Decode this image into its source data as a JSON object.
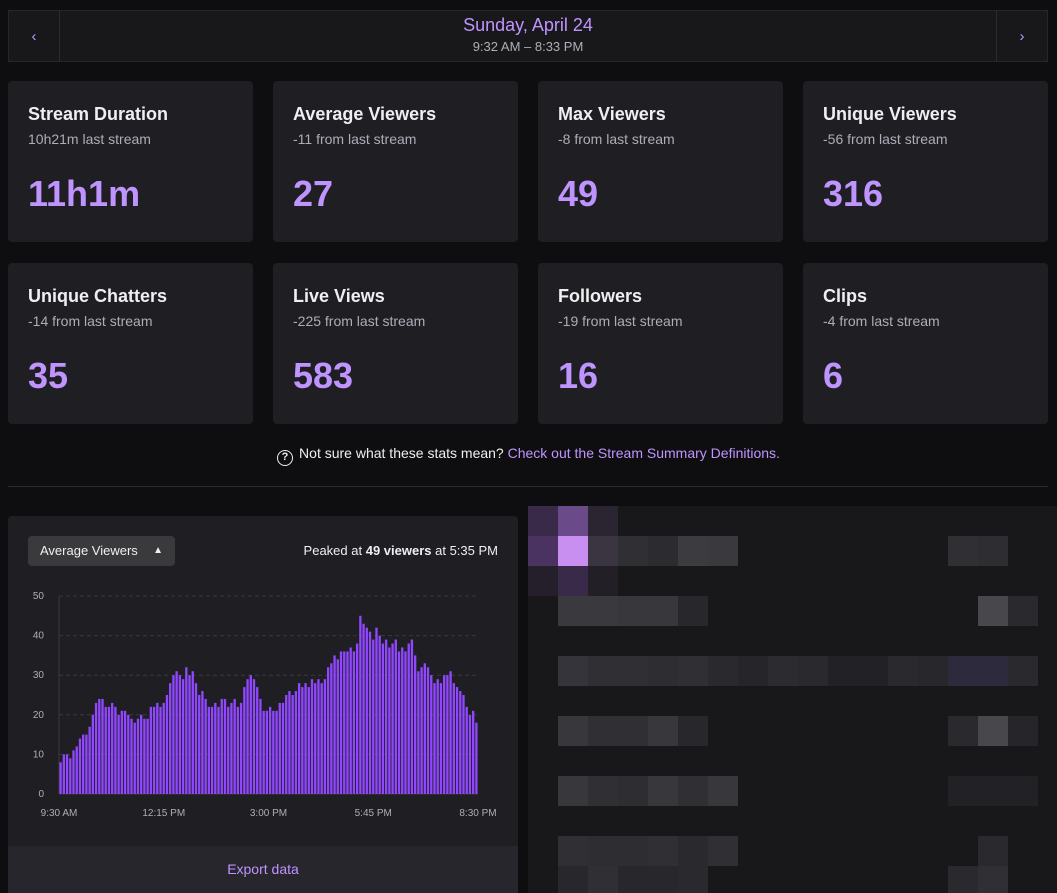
{
  "date_nav": {
    "prev_icon": "chevron-left",
    "next_icon": "chevron-right",
    "title": "Sunday, April 24",
    "time_range": "9:32 AM – 8:33 PM"
  },
  "stats": [
    {
      "title": "Stream Duration",
      "subtitle": "10h21m last stream",
      "value": "11h1m"
    },
    {
      "title": "Average Viewers",
      "subtitle": "-11 from last stream",
      "value": "27"
    },
    {
      "title": "Max Viewers",
      "subtitle": "-8 from last stream",
      "value": "49"
    },
    {
      "title": "Unique Viewers",
      "subtitle": "-56 from last stream",
      "value": "316"
    },
    {
      "title": "Unique Chatters",
      "subtitle": "-14 from last stream",
      "value": "35"
    },
    {
      "title": "Live Views",
      "subtitle": "-225 from last stream",
      "value": "583"
    },
    {
      "title": "Followers",
      "subtitle": "-19 from last stream",
      "value": "16"
    },
    {
      "title": "Clips",
      "subtitle": "-4 from last stream",
      "value": "6"
    }
  ],
  "help": {
    "icon": "question-circle-icon",
    "text": "Not sure what these stats mean?",
    "link": "Check out the Stream Summary Definitions."
  },
  "chart_panel": {
    "metric_select": "Average Viewers",
    "peak_prefix": "Peaked at",
    "peak_value": "49 viewers",
    "peak_suffix": "at 5:35 PM",
    "export_label": "Export data"
  },
  "colors": {
    "accent": "#bf94ff",
    "bar": "#9147ff",
    "background": "#0e0e10",
    "card": "#1f1f23"
  },
  "chart_data": {
    "type": "bar",
    "ylim": [
      0,
      50
    ],
    "yticks": [
      0,
      10,
      20,
      30,
      40,
      50
    ],
    "xticks": [
      "9:30 AM",
      "12:15 PM",
      "3:00 PM",
      "5:45 PM",
      "8:30 PM"
    ],
    "grid": "horizontal dashed",
    "values": [
      8,
      10,
      10,
      9,
      11,
      12,
      14,
      15,
      15,
      17,
      20,
      23,
      24,
      24,
      22,
      22,
      23,
      22,
      20,
      21,
      21,
      20,
      19,
      18,
      19,
      20,
      19,
      19,
      22,
      22,
      23,
      22,
      23,
      25,
      28,
      30,
      31,
      30,
      29,
      32,
      30,
      31,
      28,
      25,
      26,
      24,
      22,
      22,
      23,
      22,
      24,
      24,
      22,
      23,
      24,
      22,
      23,
      27,
      29,
      30,
      29,
      27,
      24,
      21,
      21,
      22,
      21,
      21,
      23,
      23,
      25,
      26,
      25,
      26,
      28,
      27,
      28,
      27,
      29,
      28,
      29,
      28,
      29,
      32,
      33,
      35,
      34,
      36,
      36,
      36,
      37,
      36,
      38,
      45,
      43,
      42,
      41,
      39,
      42,
      40,
      38,
      39,
      37,
      38,
      39,
      36,
      37,
      36,
      38,
      39,
      35,
      31,
      32,
      33,
      32,
      30,
      28,
      29,
      28,
      30,
      30,
      31,
      28,
      27,
      26,
      25,
      22,
      20,
      21,
      18
    ]
  },
  "heatmap": {
    "note": "redacted / pixelated panel",
    "cells": [
      {
        "c": 0,
        "r": 0,
        "color": "#3a2a4a"
      },
      {
        "c": 1,
        "r": 0,
        "color": "#6b4a8a"
      },
      {
        "c": 2,
        "r": 0,
        "color": "#2a2530"
      },
      {
        "c": 0,
        "r": 1,
        "color": "#4a3360"
      },
      {
        "c": 1,
        "r": 1,
        "color": "#c88ff0"
      },
      {
        "c": 2,
        "r": 1,
        "color": "#3a3540"
      },
      {
        "c": 3,
        "r": 1,
        "color": "#303034"
      },
      {
        "c": 4,
        "r": 1,
        "color": "#2c2c30"
      },
      {
        "c": 5,
        "r": 1,
        "color": "#3c3c40"
      },
      {
        "c": 6,
        "r": 1,
        "color": "#3a3a3e"
      },
      {
        "c": 14,
        "r": 1,
        "color": "#303034"
      },
      {
        "c": 15,
        "r": 1,
        "color": "#2e2e32"
      },
      {
        "c": 0,
        "r": 2,
        "color": "#241f2a"
      },
      {
        "c": 1,
        "r": 2,
        "color": "#3a2a4a"
      },
      {
        "c": 2,
        "r": 2,
        "color": "#222026"
      },
      {
        "c": 1,
        "r": 3,
        "color": "#3a3a3e"
      },
      {
        "c": 2,
        "r": 3,
        "color": "#3a3a3e"
      },
      {
        "c": 3,
        "r": 3,
        "color": "#38383c"
      },
      {
        "c": 4,
        "r": 3,
        "color": "#38383c"
      },
      {
        "c": 5,
        "r": 3,
        "color": "#28282c"
      },
      {
        "c": 15,
        "r": 3,
        "color": "#48484c"
      },
      {
        "c": 16,
        "r": 3,
        "color": "#2a2a2e"
      },
      {
        "c": 1,
        "r": 5,
        "color": "#34343a"
      },
      {
        "c": 2,
        "r": 5,
        "color": "#303034"
      },
      {
        "c": 3,
        "r": 5,
        "color": "#303034"
      },
      {
        "c": 4,
        "r": 5,
        "color": "#2e2e32"
      },
      {
        "c": 5,
        "r": 5,
        "color": "#303034"
      },
      {
        "c": 6,
        "r": 5,
        "color": "#2a2a2e"
      },
      {
        "c": 7,
        "r": 5,
        "color": "#26262a"
      },
      {
        "c": 8,
        "r": 5,
        "color": "#2c2c30"
      },
      {
        "c": 9,
        "r": 5,
        "color": "#2a2a2e"
      },
      {
        "c": 10,
        "r": 5,
        "color": "#222226"
      },
      {
        "c": 11,
        "r": 5,
        "color": "#222226"
      },
      {
        "c": 12,
        "r": 5,
        "color": "#2a2a2e"
      },
      {
        "c": 13,
        "r": 5,
        "color": "#28282c"
      },
      {
        "c": 14,
        "r": 5,
        "color": "#2e2a3e"
      },
      {
        "c": 15,
        "r": 5,
        "color": "#2e2a3e"
      },
      {
        "c": 16,
        "r": 5,
        "color": "#2a2a2e"
      },
      {
        "c": 1,
        "r": 7,
        "color": "#38383c"
      },
      {
        "c": 2,
        "r": 7,
        "color": "#303034"
      },
      {
        "c": 3,
        "r": 7,
        "color": "#303034"
      },
      {
        "c": 4,
        "r": 7,
        "color": "#38383c"
      },
      {
        "c": 5,
        "r": 7,
        "color": "#28282c"
      },
      {
        "c": 14,
        "r": 7,
        "color": "#2a2a2e"
      },
      {
        "c": 15,
        "r": 7,
        "color": "#48484c"
      },
      {
        "c": 16,
        "r": 7,
        "color": "#26262a"
      },
      {
        "c": 1,
        "r": 9,
        "color": "#38383c"
      },
      {
        "c": 2,
        "r": 9,
        "color": "#303034"
      },
      {
        "c": 3,
        "r": 9,
        "color": "#2e2e32"
      },
      {
        "c": 4,
        "r": 9,
        "color": "#38383c"
      },
      {
        "c": 5,
        "r": 9,
        "color": "#303034"
      },
      {
        "c": 6,
        "r": 9,
        "color": "#38383c"
      },
      {
        "c": 14,
        "r": 9,
        "color": "#222226"
      },
      {
        "c": 15,
        "r": 9,
        "color": "#222226"
      },
      {
        "c": 16,
        "r": 9,
        "color": "#222226"
      },
      {
        "c": 1,
        "r": 11,
        "color": "#303034"
      },
      {
        "c": 2,
        "r": 11,
        "color": "#2e2e32"
      },
      {
        "c": 3,
        "r": 11,
        "color": "#2e2e32"
      },
      {
        "c": 4,
        "r": 11,
        "color": "#303034"
      },
      {
        "c": 5,
        "r": 11,
        "color": "#2a2a2e"
      },
      {
        "c": 6,
        "r": 11,
        "color": "#303034"
      },
      {
        "c": 15,
        "r": 11,
        "color": "#2a2a2e"
      },
      {
        "c": 1,
        "r": 12,
        "color": "#28282c"
      },
      {
        "c": 2,
        "r": 12,
        "color": "#303034"
      },
      {
        "c": 3,
        "r": 12,
        "color": "#28282c"
      },
      {
        "c": 4,
        "r": 12,
        "color": "#28282c"
      },
      {
        "c": 5,
        "r": 12,
        "color": "#2a2a2e"
      },
      {
        "c": 14,
        "r": 12,
        "color": "#2a2a2e"
      },
      {
        "c": 15,
        "r": 12,
        "color": "#303034"
      }
    ]
  }
}
